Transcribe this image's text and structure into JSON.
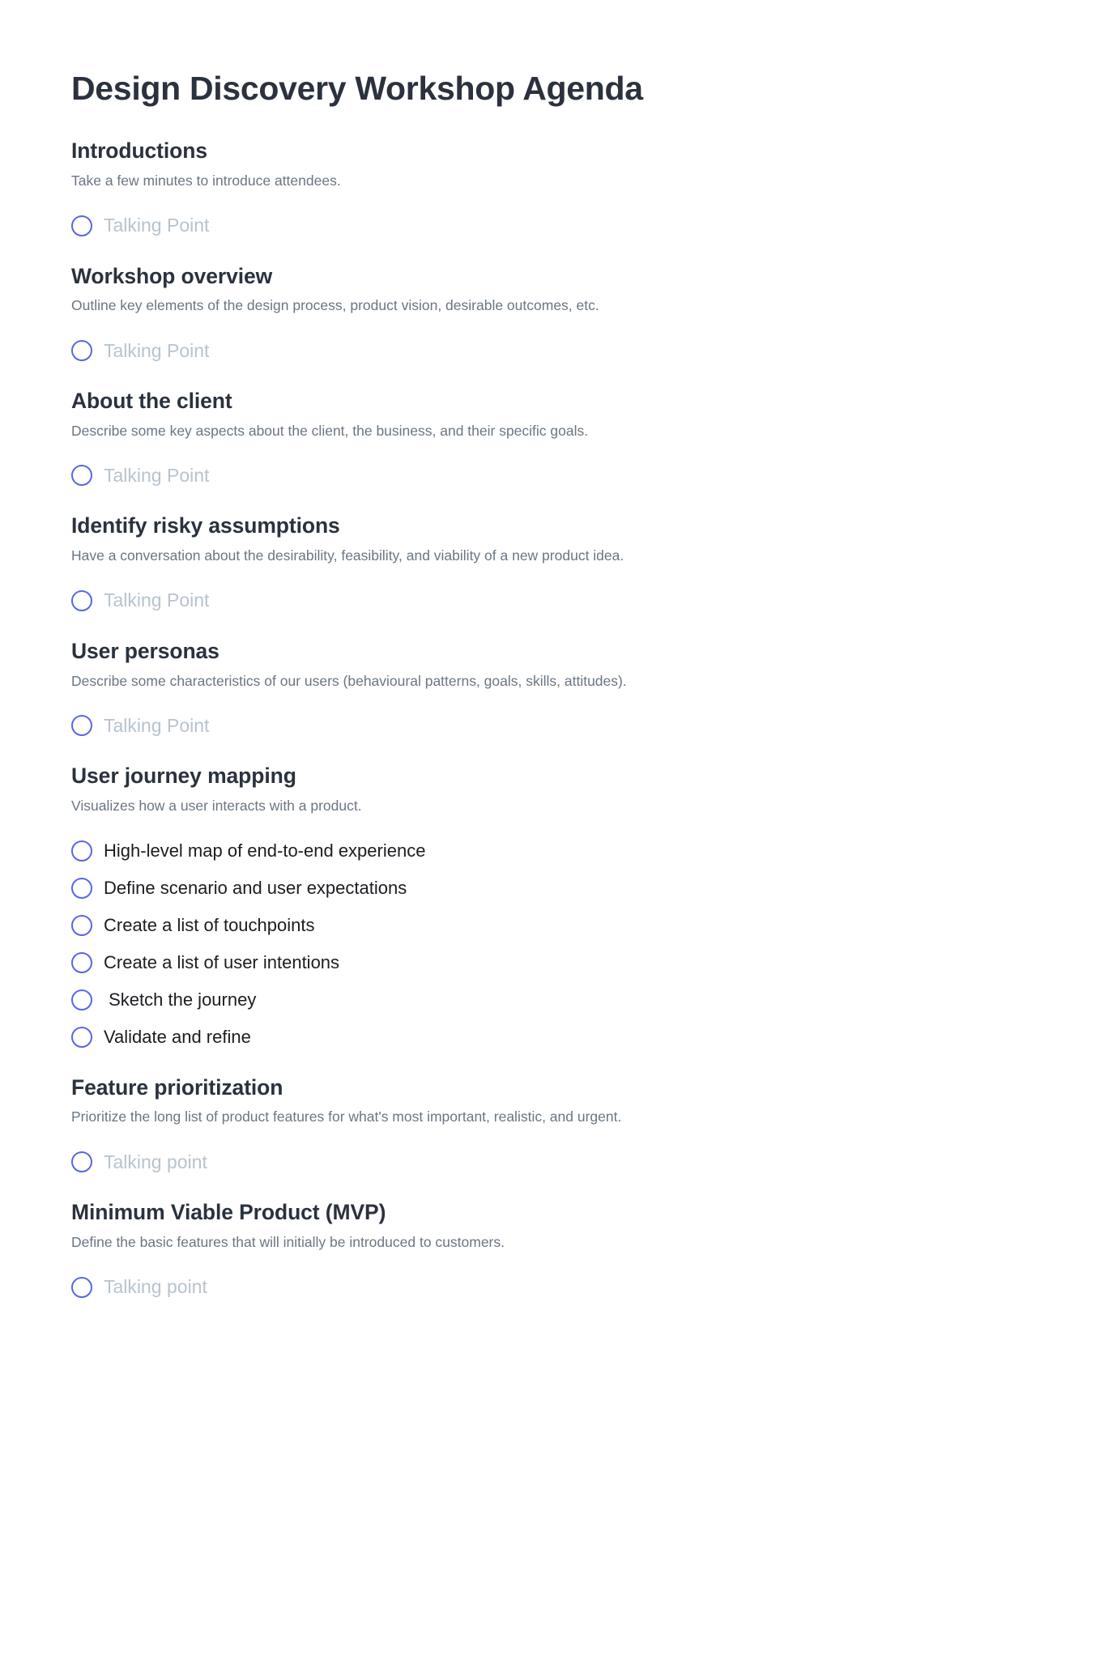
{
  "document": {
    "title": "Design Discovery Workshop Agenda"
  },
  "colors": {
    "heading": "#2b323e",
    "description": "#6b7682",
    "item_text": "#1b1d21",
    "placeholder": "#b8c3cd",
    "circle_ring": "#5b66e6",
    "background": "#ffffff"
  },
  "sections": [
    {
      "heading": "Introductions",
      "description": "Take a few minutes to introduce attendees.",
      "items": [
        {
          "label": "Talking Point",
          "placeholder": true,
          "checked": false
        }
      ]
    },
    {
      "heading": "Workshop overview",
      "description": "Outline key elements of the design process, product vision, desirable outcomes, etc.",
      "items": [
        {
          "label": "Talking Point",
          "placeholder": true,
          "checked": false
        }
      ]
    },
    {
      "heading": "About the client",
      "description": "Describe some key aspects about the client, the business, and their specific goals.",
      "items": [
        {
          "label": "Talking Point",
          "placeholder": true,
          "checked": false
        }
      ]
    },
    {
      "heading": "Identify risky assumptions",
      "description": "Have a conversation about the desirability, feasibility, and viability of a new product idea.",
      "items": [
        {
          "label": "Talking Point",
          "placeholder": true,
          "checked": false
        }
      ]
    },
    {
      "heading": "User personas",
      "description": "Describe some characteristics of our users (behavioural patterns, goals, skills, attitudes).",
      "items": [
        {
          "label": "Talking Point",
          "placeholder": true,
          "checked": false
        }
      ]
    },
    {
      "heading": "User journey mapping",
      "description": "Visualizes how a user interacts with a product.",
      "items": [
        {
          "label": "High-level map of end-to-end experience",
          "placeholder": false,
          "checked": false
        },
        {
          "label": "Define scenario and user expectations",
          "placeholder": false,
          "checked": false
        },
        {
          "label": "Create a list of touchpoints",
          "placeholder": false,
          "checked": false
        },
        {
          "label": "Create a list of user intentions",
          "placeholder": false,
          "checked": false
        },
        {
          "label": " Sketch the journey",
          "placeholder": false,
          "checked": false
        },
        {
          "label": "Validate and refine",
          "placeholder": false,
          "checked": false
        }
      ]
    },
    {
      "heading": "Feature prioritization",
      "description": "Prioritize the long list of product features for what's most important, realistic, and urgent.",
      "items": [
        {
          "label": "Talking point",
          "placeholder": true,
          "checked": false
        }
      ]
    },
    {
      "heading": "Minimum Viable Product (MVP)",
      "description": "Define the basic features that will initially be introduced to customers.",
      "items": [
        {
          "label": "Talking point",
          "placeholder": true,
          "checked": false
        }
      ]
    }
  ]
}
